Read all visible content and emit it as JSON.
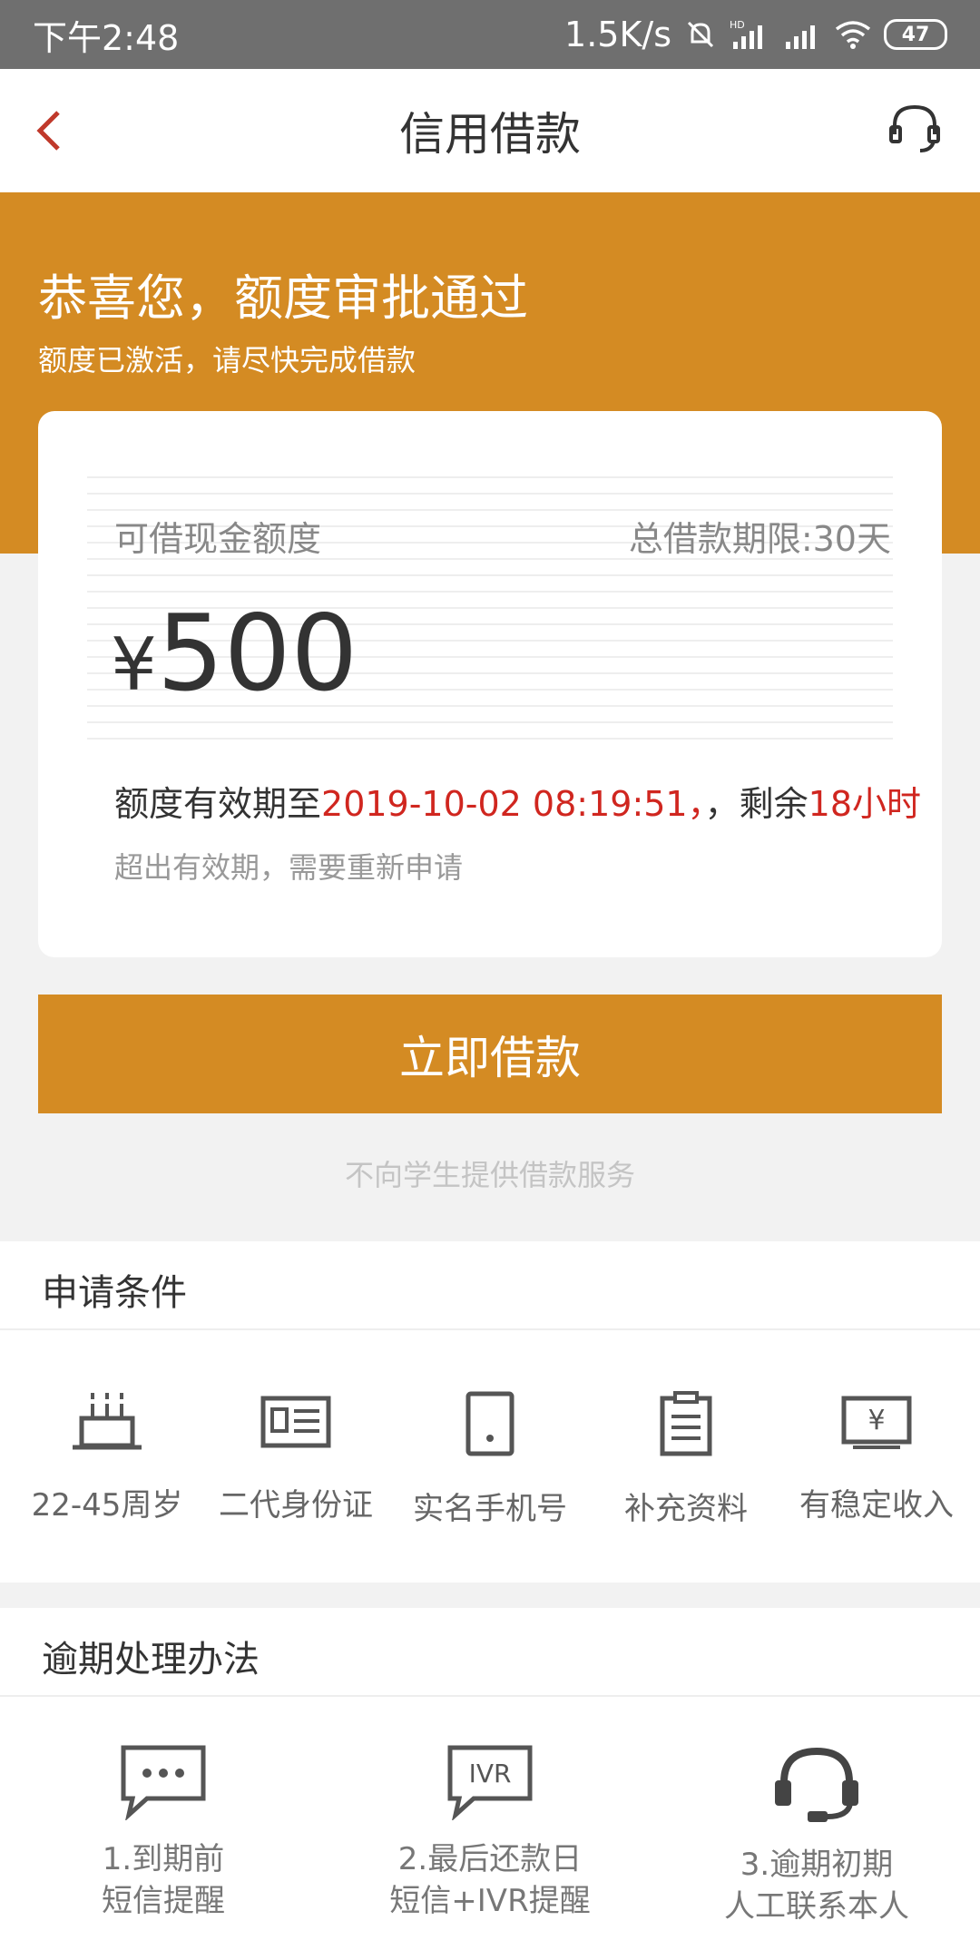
{
  "status_bar": {
    "time": "下午2:48",
    "speed": "1.5K/s",
    "battery": "47"
  },
  "navbar": {
    "title": "信用借款"
  },
  "hero": {
    "title": "恭喜您，额度审批通过",
    "subtitle": "额度已激活，请尽快完成借款"
  },
  "card": {
    "limit_label": "可借现金额度",
    "term_label": "总借款期限:30天",
    "currency": "¥",
    "amount": "500",
    "validity_prefix": "额度有效期至",
    "validity_date": "2019-10-02 08:19:51",
    "validity_mid": "，剩余",
    "validity_remaining": "18小时",
    "expire_hint": "超出有效期，需要重新申请"
  },
  "borrow_button": "立即借款",
  "student_note": "不向学生提供借款服务",
  "conditions": {
    "title": "申请条件",
    "items": [
      {
        "label": "22-45周岁",
        "icon": "cake-icon"
      },
      {
        "label": "二代身份证",
        "icon": "id-card-icon"
      },
      {
        "label": "实名手机号",
        "icon": "phone-icon"
      },
      {
        "label": "补充资料",
        "icon": "clipboard-icon"
      },
      {
        "label": "有稳定收入",
        "icon": "yen-note-icon"
      }
    ]
  },
  "overdue": {
    "title": "逾期处理办法",
    "items": [
      {
        "line1": "1.到期前",
        "line2": "短信提醒",
        "icon": "sms-icon"
      },
      {
        "line1": "2.最后还款日",
        "line2": "短信+IVR提醒",
        "icon": "ivr-icon",
        "icon_text": "IVR"
      },
      {
        "line1": "3.逾期初期",
        "line2": "人工联系本人",
        "icon": "headset-icon"
      }
    ]
  },
  "colors": {
    "accent": "#d48b23",
    "highlight_red": "#d0261f",
    "back_arrow": "#c0392b"
  }
}
